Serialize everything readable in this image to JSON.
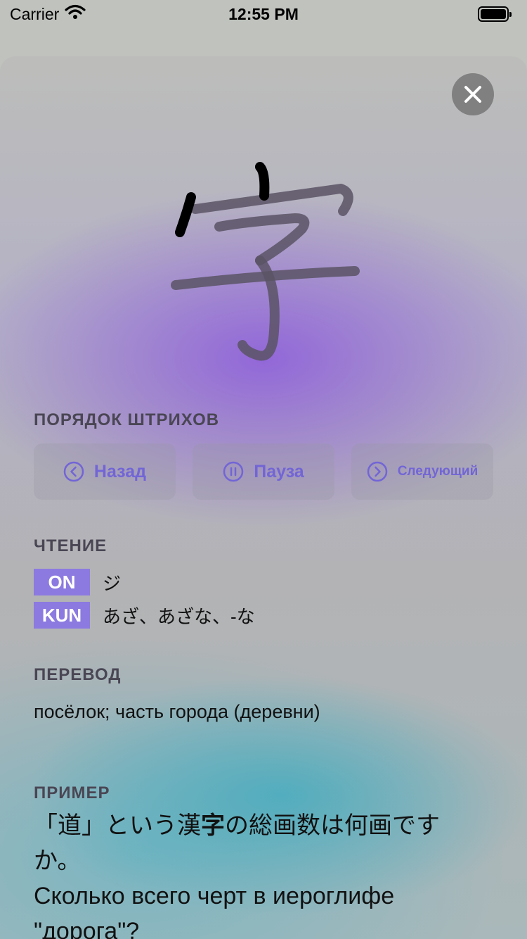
{
  "status_bar": {
    "carrier": "Carrier",
    "time": "12:55 PM",
    "battery_level": 1.0
  },
  "stroke_order": {
    "title": "ПОРЯДОК ШТРИХОВ",
    "back_label": "Назад",
    "pause_label": "Пауза",
    "next_label": "Следующий"
  },
  "reading": {
    "title": "ЧТЕНИЕ",
    "on_label": "ON",
    "on_value": "ジ",
    "kun_label": "KUN",
    "kun_value": "あざ、あざな、-な"
  },
  "translation": {
    "title": "ПЕРЕВОД",
    "text": "посёлок; часть города (деревни)"
  },
  "example": {
    "title": "ПРИМЕР",
    "jp_before": "「道」という漢",
    "jp_highlight": "字",
    "jp_after": "の総画数は何画ですか。",
    "ru": "Сколько всего черт в иероглифе \"дорога\"?"
  },
  "colors": {
    "accent": "#8c7ae0",
    "button_text": "#7265d6",
    "stroke_done": "#000000",
    "stroke_pending": "#5a5365"
  },
  "icons": {
    "close": "close-icon",
    "back": "chevron-left-circle-icon",
    "pause": "pause-circle-icon",
    "next": "chevron-right-circle-icon"
  }
}
